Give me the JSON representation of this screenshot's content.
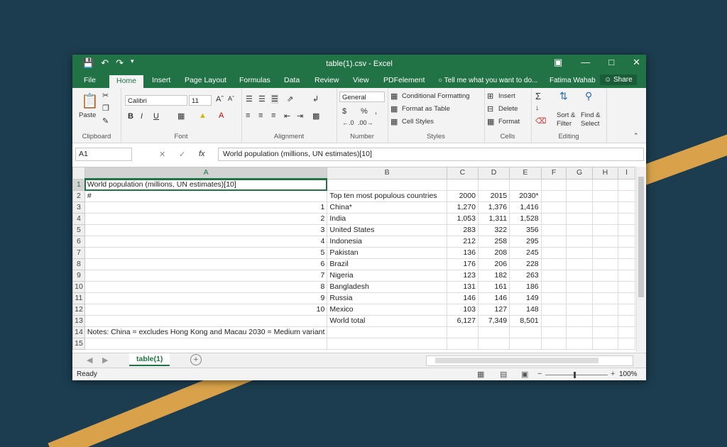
{
  "window": {
    "title": "table(1).csv - Excel",
    "user": "Fatima Wahab",
    "share_label": "Share"
  },
  "tabs": [
    "File",
    "Home",
    "Insert",
    "Page Layout",
    "Formulas",
    "Data",
    "Review",
    "View",
    "PDFelement"
  ],
  "active_tab": "Home",
  "tell_me": "Tell me what you want to do...",
  "ribbon": {
    "clipboard": {
      "label": "Clipboard",
      "paste": "Paste"
    },
    "font": {
      "label": "Font",
      "name": "Calibri",
      "size": "11",
      "bold": "B",
      "italic": "I",
      "underline": "U"
    },
    "alignment": {
      "label": "Alignment"
    },
    "number": {
      "label": "Number",
      "format": "General",
      "currency": "$",
      "percent": "%",
      "comma": ","
    },
    "styles": {
      "label": "Styles",
      "conditional": "Conditional Formatting",
      "format_table": "Format as Table",
      "cell_styles": "Cell Styles"
    },
    "cells": {
      "label": "Cells",
      "insert": "Insert",
      "delete": "Delete",
      "format": "Format"
    },
    "editing": {
      "label": "Editing",
      "sort": "Sort &",
      "sort2": "Filter",
      "find": "Find &",
      "find2": "Select"
    }
  },
  "formula_bar": {
    "name_box": "A1",
    "content": "World population (millions, UN estimates)[10]"
  },
  "columns": [
    "A",
    "B",
    "C",
    "D",
    "E",
    "F",
    "G",
    "H",
    "I"
  ],
  "rows": [
    {
      "n": "1",
      "a": "World population (millions, UN estimates)[10]",
      "b": "",
      "c": "",
      "d": "",
      "e": ""
    },
    {
      "n": "2",
      "a": "#",
      "b": "Top ten most populous countries",
      "c": "2000",
      "d": "2015",
      "e": "2030*"
    },
    {
      "n": "3",
      "a": "1",
      "b": "China*",
      "c": "1,270",
      "d": "1,376",
      "e": "1,416"
    },
    {
      "n": "4",
      "a": "2",
      "b": "India",
      "c": "1,053",
      "d": "1,311",
      "e": "1,528"
    },
    {
      "n": "5",
      "a": "3",
      "b": "United States",
      "c": "283",
      "d": "322",
      "e": "356"
    },
    {
      "n": "6",
      "a": "4",
      "b": "Indonesia",
      "c": "212",
      "d": "258",
      "e": "295"
    },
    {
      "n": "7",
      "a": "5",
      "b": "Pakistan",
      "c": "136",
      "d": "208",
      "e": "245"
    },
    {
      "n": "8",
      "a": "6",
      "b": "Brazil",
      "c": "176",
      "d": "206",
      "e": "228"
    },
    {
      "n": "9",
      "a": "7",
      "b": "Nigeria",
      "c": "123",
      "d": "182",
      "e": "263"
    },
    {
      "n": "10",
      "a": "8",
      "b": "Bangladesh",
      "c": "131",
      "d": "161",
      "e": "186"
    },
    {
      "n": "11",
      "a": "9",
      "b": "Russia",
      "c": "146",
      "d": "146",
      "e": "149"
    },
    {
      "n": "12",
      "a": "10",
      "b": "Mexico",
      "c": "103",
      "d": "127",
      "e": "148"
    },
    {
      "n": "13",
      "a": "",
      "b": "World total",
      "c": "6,127",
      "d": "7,349",
      "e": "8,501"
    },
    {
      "n": "14",
      "a": "Notes: China = excludes Hong Kong and Macau 2030 = Medium variant",
      "b": "",
      "c": "",
      "d": "",
      "e": ""
    },
    {
      "n": "15",
      "a": "",
      "b": "",
      "c": "",
      "d": "",
      "e": ""
    }
  ],
  "sheet_tab": "table(1)",
  "status": {
    "ready": "Ready",
    "zoom": "100%"
  },
  "colors": {
    "accent": "#217346",
    "desktop": "#1c3d4f",
    "stripe": "#d9a24a"
  }
}
